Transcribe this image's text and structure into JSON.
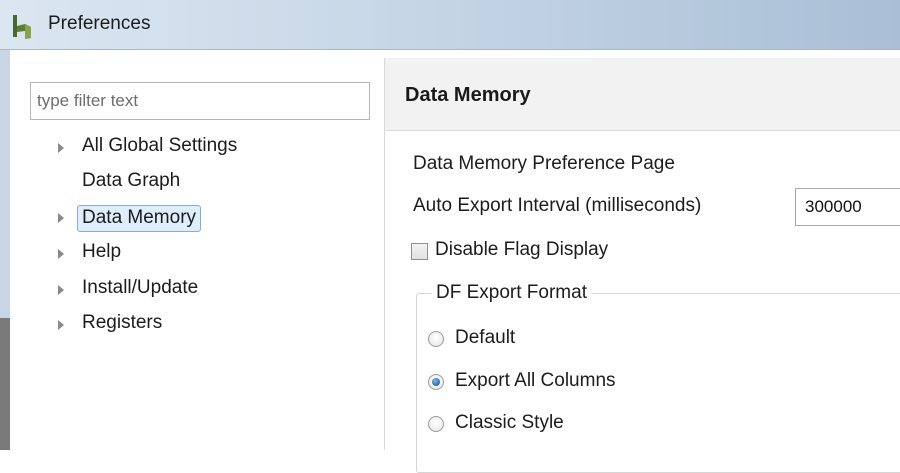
{
  "window": {
    "title": "Preferences",
    "icon": "preferences-app-icon"
  },
  "navigation": {
    "filter_placeholder": "type filter text",
    "items": [
      {
        "label": "All Global Settings",
        "expandable": true,
        "selected": false
      },
      {
        "label": "Data Graph",
        "expandable": false,
        "selected": false
      },
      {
        "label": "Data Memory",
        "expandable": true,
        "selected": true
      },
      {
        "label": "Help",
        "expandable": true,
        "selected": false
      },
      {
        "label": "Install/Update",
        "expandable": true,
        "selected": false
      },
      {
        "label": "Registers",
        "expandable": true,
        "selected": false
      }
    ]
  },
  "page": {
    "title": "Data Memory",
    "description": "Data Memory Preference Page",
    "auto_export": {
      "label": "Auto Export Interval (milliseconds)",
      "value": "300000"
    },
    "disable_flag": {
      "label": "Disable Flag Display",
      "checked": false
    },
    "export_format": {
      "legend": "DF Export Format",
      "options": [
        {
          "label": "Default",
          "selected": false
        },
        {
          "label": "Export All Columns",
          "selected": true
        },
        {
          "label": "Classic Style",
          "selected": false
        }
      ]
    }
  },
  "colors": {
    "selection_fill": "#dfeefc",
    "selection_border": "#84acdd",
    "radio_accent": "#2b6cb3"
  }
}
